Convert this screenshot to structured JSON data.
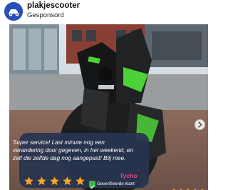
{
  "post": {
    "account_name": "plakjescooter",
    "sponsored_label": "Gesponsord"
  },
  "icons": {
    "avatar": "scooter-logo-icon",
    "next": "chevron-right-icon",
    "star": "star-icon",
    "verified": "check-icon"
  },
  "review": {
    "text": "Super service! Last minute nog een verandering door gegeven, in het weekend, en zelf die zelfde dag nog aangepast! Blij mee.",
    "reviewer": "Tycho",
    "rating": 5,
    "verified_label": "Geverifieerde klant"
  },
  "colors": {
    "brand": "#2b4fb8",
    "star": "#f5a623",
    "card": "#283450",
    "reviewer_name": "#e8447f",
    "verified": "#3db54a",
    "accent_green": "#4cd137"
  }
}
